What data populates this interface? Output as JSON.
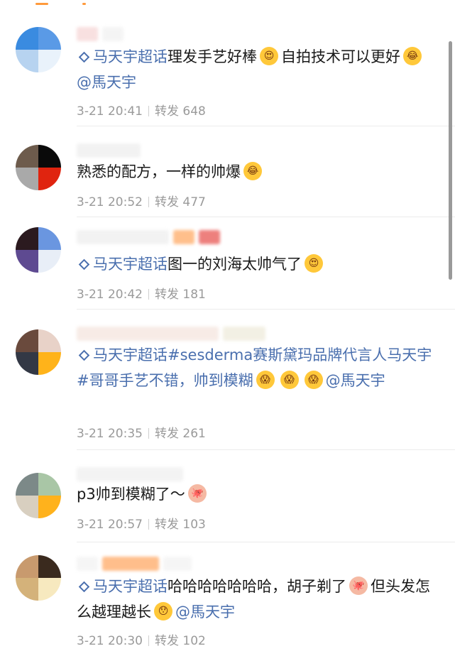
{
  "comments": [
    {
      "avatar_colors": [
        "#3a8be0",
        "#5a9ae6",
        "#b7d3f0",
        "#e9f2fb"
      ],
      "nick_bars": [
        "#f3c7c7",
        "#ececec"
      ],
      "tag": "马天宇超话",
      "text_a": "理发手艺好棒",
      "emoji_a": "😍",
      "text_b": "自拍技术可以更好",
      "emoji_b": "😂",
      "mention": "@馬天宇",
      "time": "3-21 20:41",
      "repost_label": "转发",
      "repost_count": "648"
    },
    {
      "avatar_colors": [
        "#6d5b4c",
        "#0a0a0a",
        "#a9a9a9",
        "#e0240f"
      ],
      "text": "熟悉的配方，一样的帅爆",
      "emoji": "😂",
      "time": "3-21 20:52",
      "repost_label": "转发",
      "repost_count": "477"
    },
    {
      "avatar_colors": [
        "#2b1a1f",
        "#6a96e0",
        "#5e4a91",
        "#e8eef7"
      ],
      "nick_bars": [
        "#ff8c2e",
        "#e01a14"
      ],
      "tag": "马天宇超话",
      "text": "图一的刘海太帅气了",
      "emoji": "😍",
      "time": "3-21 20:42",
      "repost_label": "转发",
      "repost_count": "181"
    },
    {
      "avatar_colors": [
        "#6a4a3d",
        "#e8d2c8",
        "#333845",
        "#ffb31a"
      ],
      "tag": "马天宇超话",
      "text_a": "#sesderma赛斯黛玛品牌代言人马天宇#哥哥手艺不错，帅到模糊",
      "emoji": "😱",
      "mention": "@馬天宇",
      "time": "3-21 20:35",
      "repost_label": "转发",
      "repost_count": "261"
    },
    {
      "avatar_colors": [
        "#7c8988",
        "#a9c6a6",
        "#d8cfc0",
        "#ffb21c"
      ],
      "text": "p3帅到模糊了～",
      "emoji": "🐙",
      "time": "3-21 20:57",
      "repost_label": "转发",
      "repost_count": "103"
    },
    {
      "avatar_colors": [
        "#c89a6e",
        "#3a2a1e",
        "#d4b27a",
        "#f7e9bf"
      ],
      "nick_bars": [
        "#ff8a2e",
        "#ff8a2e"
      ],
      "tag": "马天宇超话",
      "text_a": "哈哈哈哈哈哈哈，胡子剃了",
      "emoji_a": "🐙",
      "text_b": "但头发怎么越理越长",
      "emoji_b": "😯",
      "mention": "@馬天宇",
      "time": "3-21 20:30",
      "repost_label": "转发",
      "repost_count": "102"
    }
  ]
}
